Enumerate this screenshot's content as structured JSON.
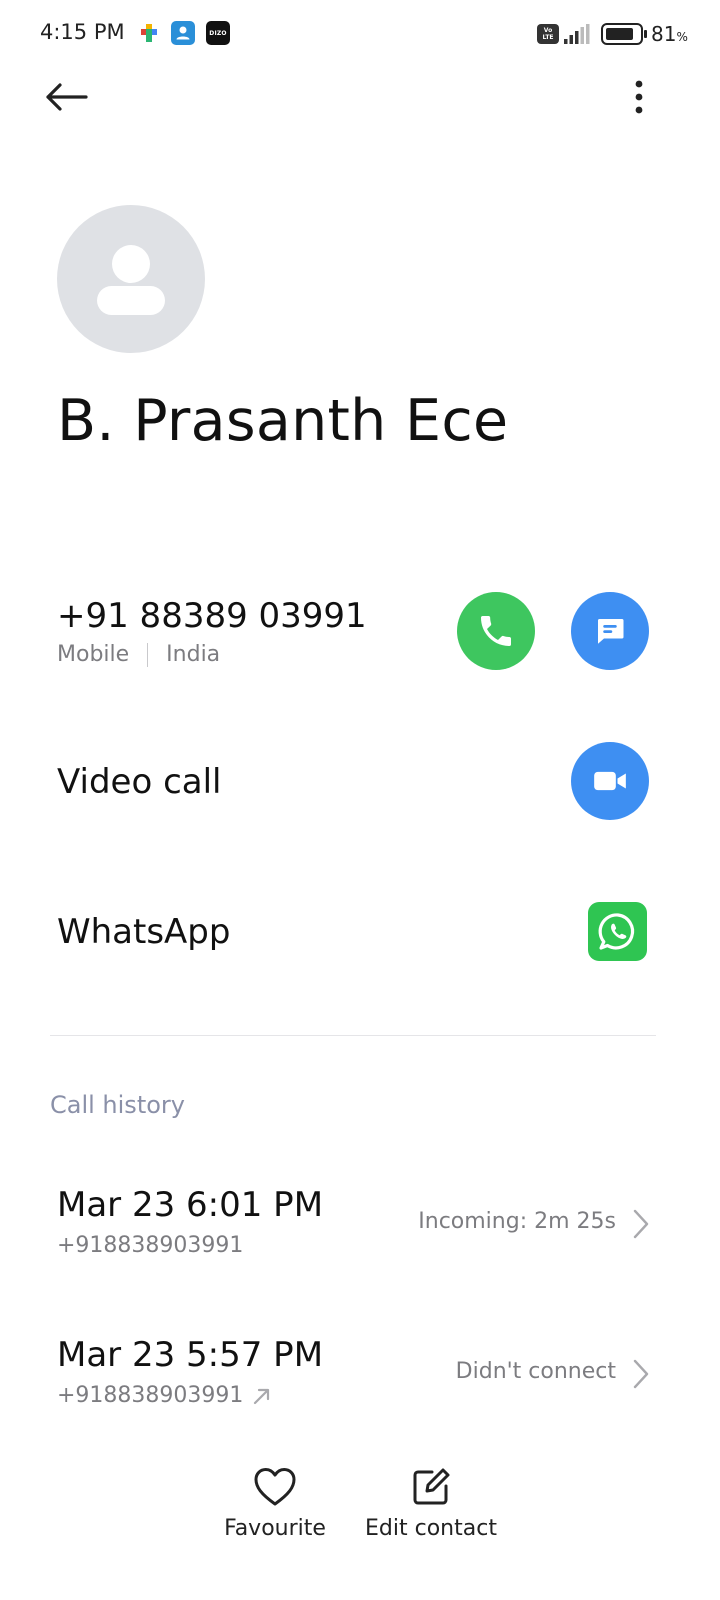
{
  "status_bar": {
    "time": "4:15 PM",
    "notification_icons": [
      "google-play-games-icon",
      "contacts-app-icon",
      "dizo-icon"
    ],
    "dizo_label": "DIZO",
    "volte_label": "Vo LTE",
    "battery_percent": "81",
    "battery_unit": "%"
  },
  "header": {
    "back_icon": "back-arrow-icon",
    "more_icon": "more-vertical-icon"
  },
  "contact": {
    "name": "B. Prasanth Ece",
    "avatar_icon": "person-placeholder-icon"
  },
  "phone": {
    "number": "+91 88389 03991",
    "type": "Mobile",
    "region": "India",
    "call_icon": "phone-icon",
    "message_icon": "message-icon"
  },
  "video_call": {
    "label": "Video call",
    "icon": "video-camera-icon"
  },
  "whatsapp": {
    "label": "WhatsApp",
    "icon": "whatsapp-icon"
  },
  "call_history": {
    "title": "Call history",
    "entries": [
      {
        "datetime": "Mar 23 6:01 PM",
        "number": "+918838903991",
        "status": "Incoming: 2m 25s",
        "outgoing": false
      },
      {
        "datetime": "Mar 23 5:57 PM",
        "number": "+918838903991",
        "status": "Didn't connect",
        "outgoing": true
      }
    ]
  },
  "bottom_bar": {
    "favourite_label": "Favourite",
    "edit_label": "Edit contact"
  },
  "colors": {
    "call_green": "#3ec65f",
    "action_blue": "#3e8ff2",
    "whatsapp_green": "#2fc552",
    "avatar_grey": "#dfe1e5",
    "section_title": "#8a90a8"
  }
}
